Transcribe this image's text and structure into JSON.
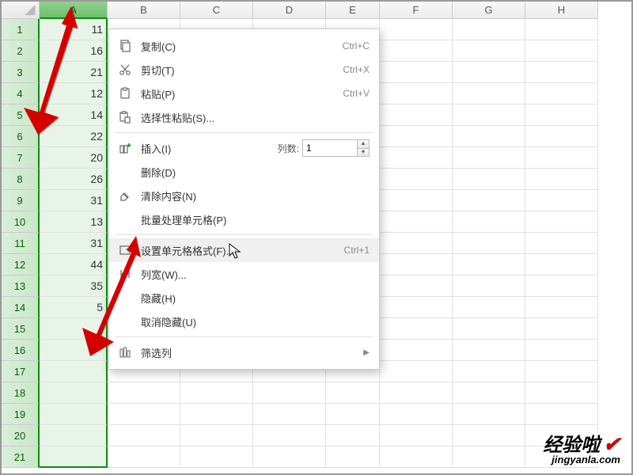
{
  "columns": [
    "A",
    "B",
    "C",
    "D",
    "E",
    "F",
    "G",
    "H"
  ],
  "selected_column": "A",
  "rows": 21,
  "cell_values": {
    "A1": "11",
    "A2": "16",
    "A3": "21",
    "A4": "12",
    "A5": "14",
    "A6": "22",
    "A7": "20",
    "A8": "26",
    "A9": "31",
    "A10": "13",
    "A11": "31",
    "A12": "44",
    "A13": "35",
    "A14": "5"
  },
  "context_menu": {
    "copy": {
      "label": "复制(C)",
      "shortcut": "Ctrl+C"
    },
    "cut": {
      "label": "剪切(T)",
      "shortcut": "Ctrl+X"
    },
    "paste": {
      "label": "粘贴(P)",
      "shortcut": "Ctrl+V"
    },
    "paste_special": {
      "label": "选择性粘贴(S)..."
    },
    "insert": {
      "label": "插入(I)",
      "count_label": "列数:",
      "count_value": "1"
    },
    "delete": {
      "label": "删除(D)"
    },
    "clear": {
      "label": "清除内容(N)"
    },
    "batch": {
      "label": "批量处理单元格(P)"
    },
    "format_cells": {
      "label": "设置单元格格式(F)...",
      "shortcut": "Ctrl+1"
    },
    "col_width": {
      "label": "列宽(W)..."
    },
    "hide": {
      "label": "隐藏(H)"
    },
    "unhide": {
      "label": "取消隐藏(U)"
    },
    "filter": {
      "label": "筛选列"
    }
  },
  "watermark": {
    "main": "经验啦",
    "sub": "jingyanla.com"
  }
}
